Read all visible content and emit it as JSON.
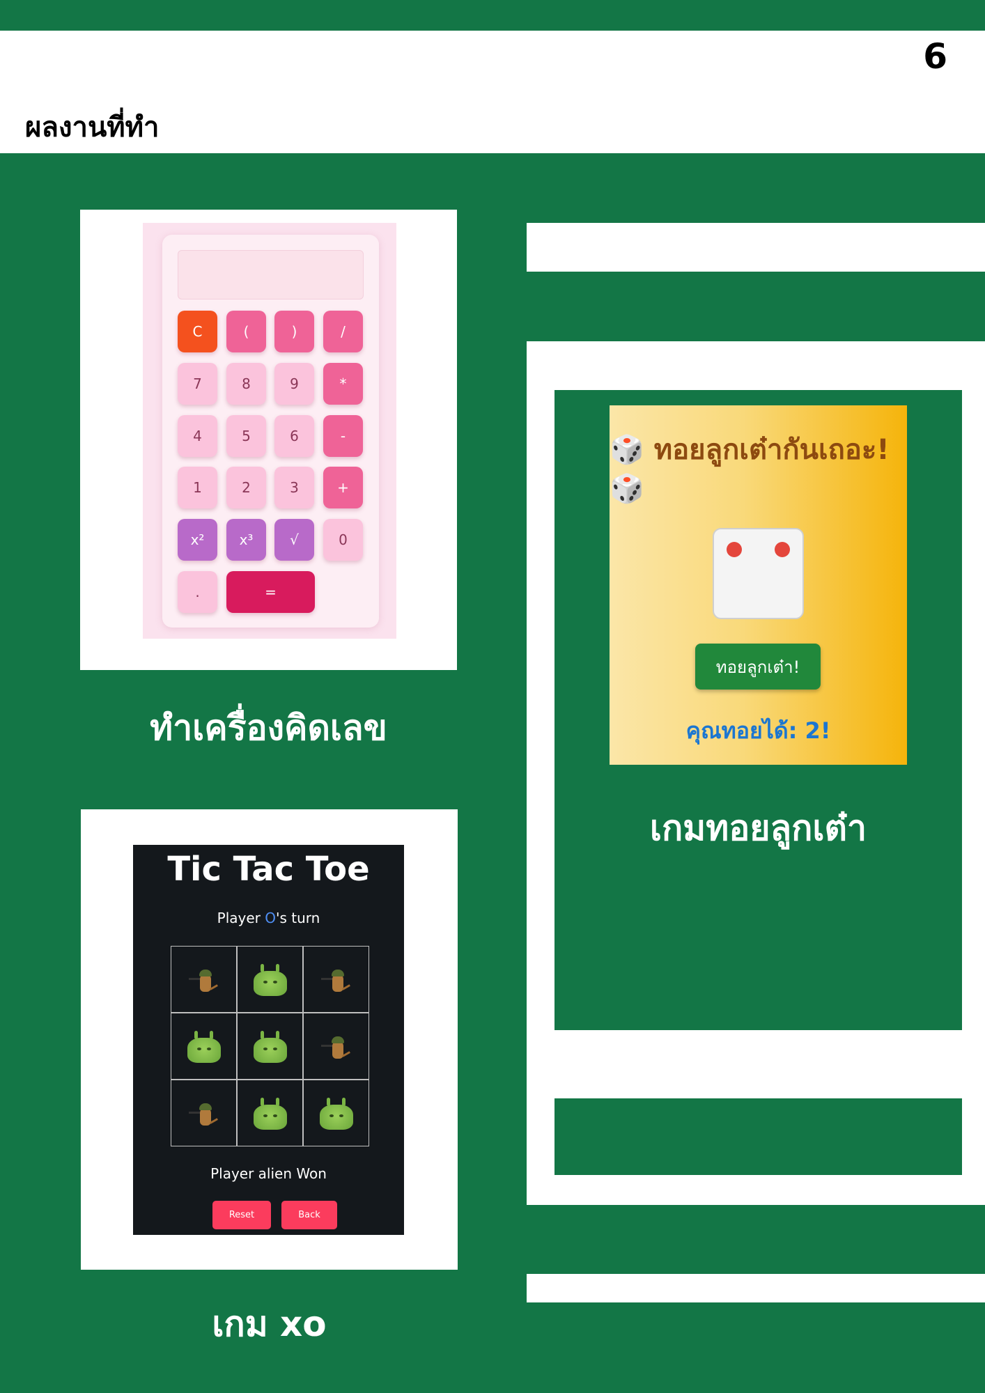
{
  "page": {
    "number": "6",
    "title": "ผลงานที่ทำ"
  },
  "calculator": {
    "caption": "ทำเครื่องคิดเลข",
    "keys": {
      "clear": "C",
      "lparen": "(",
      "rparen": ")",
      "divide": "/",
      "seven": "7",
      "eight": "8",
      "nine": "9",
      "multiply": "*",
      "four": "4",
      "five": "5",
      "six": "6",
      "minus": "-",
      "one": "1",
      "two": "2",
      "three": "3",
      "plus": "+",
      "square": "x²",
      "cube": "x³",
      "sqrt": "√",
      "zero": "0",
      "dot": ".",
      "equals": "="
    }
  },
  "dice": {
    "caption": "เกมทอยลูกเต๋า",
    "title_icon": "🎲",
    "title": "ทอยลูกเต๋ากันเถอะ!",
    "value": 2,
    "roll_button": "ทอยลูกเต๋า!",
    "result": "คุณทอยได้: 2!"
  },
  "tictactoe": {
    "caption": "เกม xo",
    "title": "Tic Tac Toe",
    "turn_prefix": "Player ",
    "turn_mark": "O",
    "turn_suffix": "'s turn",
    "board": [
      "soldier-cat",
      "alien",
      "soldier-cat",
      "alien",
      "alien",
      "soldier-cat",
      "soldier-cat",
      "alien",
      "alien"
    ],
    "status": "Player alien Won",
    "reset_button": "Reset",
    "back_button": "Back"
  },
  "colors": {
    "page_green": "#137646",
    "calc_clear": "#f4511e",
    "calc_operator": "#ef6397",
    "calc_function": "#b86ac9",
    "calc_equals": "#d81b5d",
    "dice_button": "#21883b",
    "dice_result": "#1b76d1",
    "ttt_button": "#fb3c5d"
  }
}
